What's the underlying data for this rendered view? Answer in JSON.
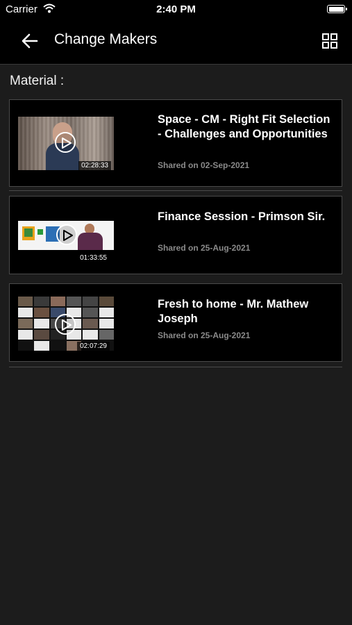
{
  "status_bar": {
    "carrier": "Carrier",
    "time": "2:40 PM"
  },
  "header": {
    "title": "Change Makers"
  },
  "section": {
    "label": "Material :"
  },
  "videos": [
    {
      "title": "Space - CM - Right Fit Selection - Challenges and Opportunities",
      "shared": "Shared on 02-Sep-2021",
      "duration": "02:28:33"
    },
    {
      "title": "Finance Session - Primson Sir.",
      "shared": "Shared on 25-Aug-2021",
      "duration": "01:33:55"
    },
    {
      "title": "Fresh to home  - Mr. Mathew Joseph",
      "shared": "Shared on 25-Aug-2021",
      "duration": "02:07:29"
    }
  ],
  "colors": {
    "background": "#1c1c1c",
    "card": "#000000",
    "border": "#4a4a4a",
    "secondary_text": "#8a8a8a"
  }
}
